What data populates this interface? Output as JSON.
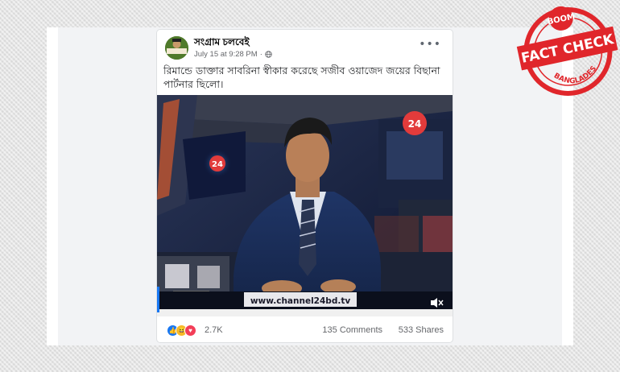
{
  "post": {
    "page_name": "সংগ্রাম চলবেই",
    "timestamp": "July 15 at 9:28 PM",
    "privacy_icon": "globe-icon",
    "more_label": "•••",
    "text": "রিমান্ডে ডাক্তার সাবরিনা স্বীকার করেছে সজীব ওয়াজেদ জয়ের বিছানা পার্টনার ছিলো।",
    "reaction_count": "2.7K",
    "comments": "135 Comments",
    "shares": "533 Shares"
  },
  "video": {
    "channel_logo": "24",
    "ticker_url": "www.channel24bd.tv",
    "volume_icon": "speaker-muted-icon"
  },
  "stamp": {
    "top": "BOOM",
    "main": "FACT CHECK",
    "bottom": "BANGLADESH"
  },
  "colors": {
    "stamp_red": "#e0262b",
    "link_blue": "#1877f2",
    "like": "#1877f2",
    "love": "#f33e58",
    "haha": "#f7b928"
  }
}
